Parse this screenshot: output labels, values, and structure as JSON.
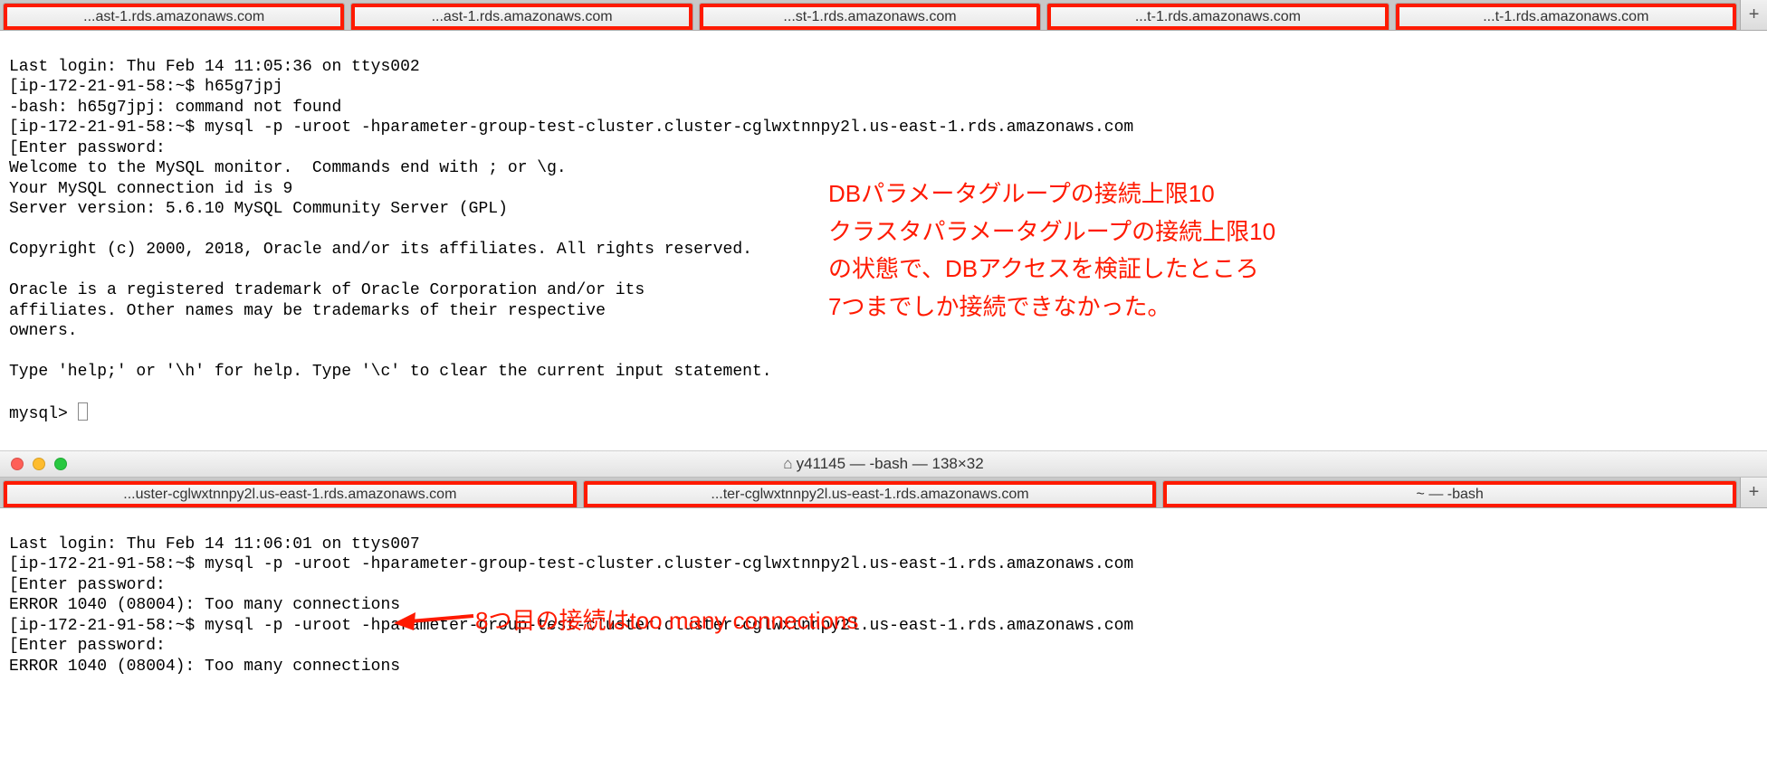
{
  "topWindow": {
    "tabs": [
      "...ast-1.rds.amazonaws.com",
      "...ast-1.rds.amazonaws.com",
      "...st-1.rds.amazonaws.com",
      "...t-1.rds.amazonaws.com",
      "...t-1.rds.amazonaws.com"
    ],
    "addLabel": "+",
    "terminalLines": [
      "Last login: Thu Feb 14 11:05:36 on ttys002",
      "[ip-172-21-91-58:~$ h65g7jpj",
      "-bash: h65g7jpj: command not found",
      "[ip-172-21-91-58:~$ mysql -p -uroot -hparameter-group-test-cluster.cluster-cglwxtnnpy2l.us-east-1.rds.amazonaws.com",
      "[Enter password:",
      "Welcome to the MySQL monitor.  Commands end with ; or \\g.",
      "Your MySQL connection id is 9",
      "Server version: 5.6.10 MySQL Community Server (GPL)",
      "",
      "Copyright (c) 2000, 2018, Oracle and/or its affiliates. All rights reserved.",
      "",
      "Oracle is a registered trademark of Oracle Corporation and/or its",
      "affiliates. Other names may be trademarks of their respective",
      "owners.",
      "",
      "Type 'help;' or '\\h' for help. Type '\\c' to clear the current input statement.",
      "",
      "mysql> "
    ]
  },
  "annotation": {
    "line1": "DBパラメータグループの接続上限10",
    "line2": "クラスタパラメータグループの接続上限10",
    "line3": "の状態で、DBアクセスを検証したところ",
    "line4": "7つまでしか接続できなかった。"
  },
  "bottomWindow": {
    "title": "y41145 — -bash — 138×32",
    "homeIcon": "⌂",
    "tabs": [
      "...uster-cglwxtnnpy2l.us-east-1.rds.amazonaws.com",
      "...ter-cglwxtnnpy2l.us-east-1.rds.amazonaws.com",
      "~ — -bash"
    ],
    "addLabel": "+",
    "terminalLines": [
      "Last login: Thu Feb 14 11:06:01 on ttys007",
      "[ip-172-21-91-58:~$ mysql -p -uroot -hparameter-group-test-cluster.cluster-cglwxtnnpy2l.us-east-1.rds.amazonaws.com",
      "[Enter password:",
      "ERROR 1040 (08004): Too many connections",
      "[ip-172-21-91-58:~$ mysql -p -uroot -hparameter-group-test-cluster.cluster-cglwxtnnpy2l.us-east-1.rds.amazonaws.com",
      "[Enter password:",
      "ERROR 1040 (08004): Too many connections"
    ]
  },
  "arrowLabel": "8つ目の接続はtoo many connections",
  "colors": {
    "highlight": "#ff1a00"
  }
}
